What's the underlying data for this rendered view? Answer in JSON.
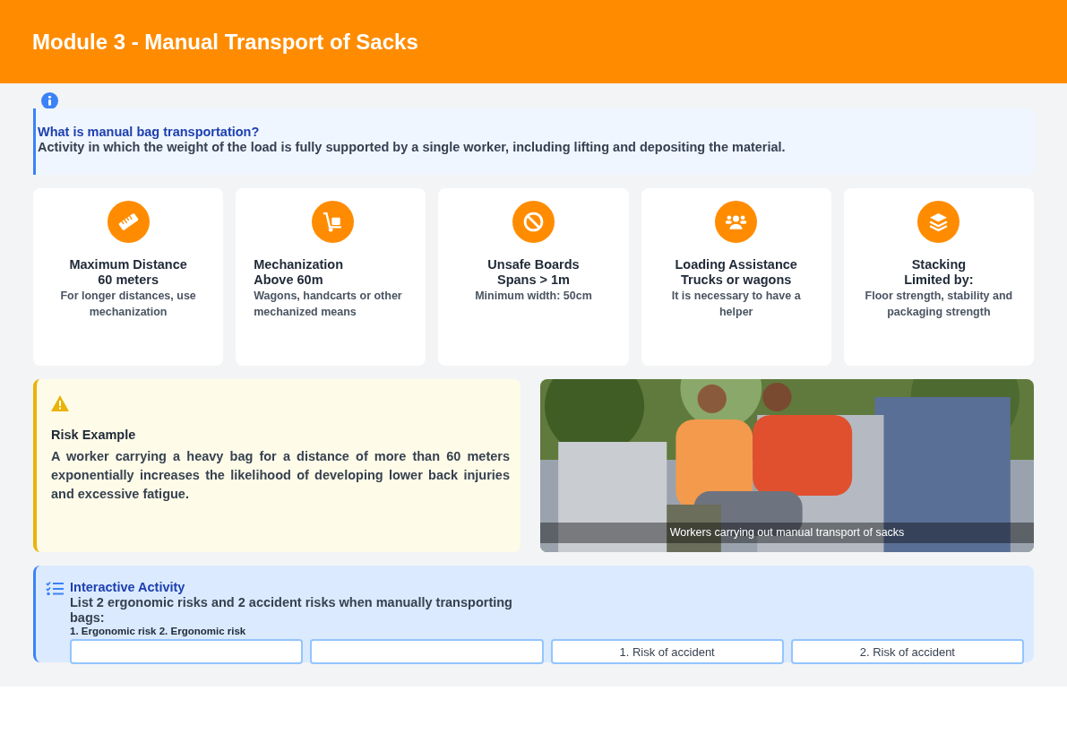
{
  "header": {
    "title": "Module 3 - Manual Transport of Sacks"
  },
  "definition": {
    "title": "What is manual bag transportation?",
    "text": "Activity in which the weight of the load is fully supported by a single worker, including lifting and depositing the material."
  },
  "cards": [
    {
      "title": "Maximum Distance",
      "value": "60 meters",
      "note": "For longer distances, use mechanization"
    },
    {
      "title": "Mechanization",
      "value": "Above 60m",
      "note": "Wagons, handcarts or other mechanized means"
    },
    {
      "title": "Unsafe Boards",
      "value": "Spans > 1m",
      "note": "Minimum width: 50cm"
    },
    {
      "title": "Loading Assistance",
      "value": "Trucks or wagons",
      "note": "It is necessary to have a helper"
    },
    {
      "title": "Stacking",
      "value": "Limited by:",
      "note": "Floor strength, stability and packaging strength"
    }
  ],
  "risk": {
    "title": "Risk Example",
    "text": "A worker carrying a heavy bag for a distance of more than 60 meters exponentially increases the likelihood of developing lower back injuries and excessive fatigue."
  },
  "photo": {
    "kind": "picture",
    "caption": "Workers carrying out manual transport of sacks"
  },
  "activity": {
    "title": "Interactive Activity",
    "prompt": "List 2 ergonomic risks and 2 accident risks when manually transporting bags:",
    "hint": "1. Ergonomic risk 2. Ergonomic risk",
    "fields": [
      {
        "kind": "blank"
      },
      {
        "kind": "blank"
      },
      {
        "kind": "hinted",
        "placeholder": "1. Risk of accident"
      },
      {
        "kind": "hinted",
        "placeholder": "2. Risk of accident"
      }
    ]
  }
}
